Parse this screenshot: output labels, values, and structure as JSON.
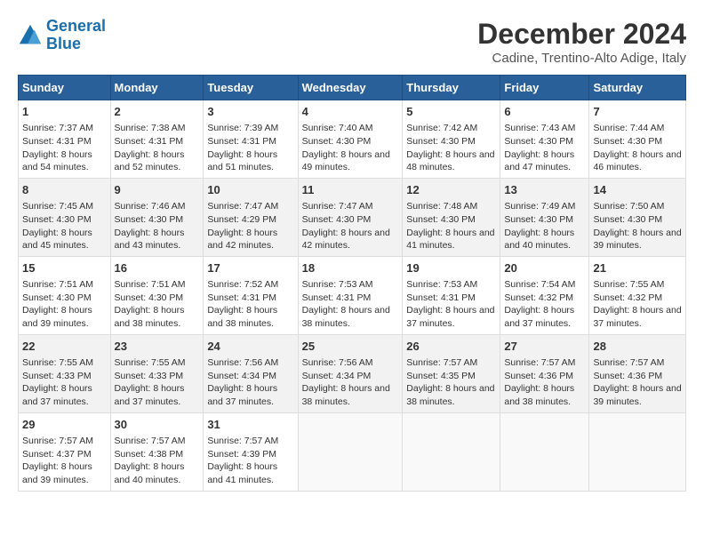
{
  "header": {
    "logo_line1": "General",
    "logo_line2": "Blue",
    "month": "December 2024",
    "location": "Cadine, Trentino-Alto Adige, Italy"
  },
  "days_of_week": [
    "Sunday",
    "Monday",
    "Tuesday",
    "Wednesday",
    "Thursday",
    "Friday",
    "Saturday"
  ],
  "weeks": [
    [
      {
        "day": "1",
        "sunrise": "7:37 AM",
        "sunset": "4:31 PM",
        "daylight": "8 hours and 54 minutes."
      },
      {
        "day": "2",
        "sunrise": "7:38 AM",
        "sunset": "4:31 PM",
        "daylight": "8 hours and 52 minutes."
      },
      {
        "day": "3",
        "sunrise": "7:39 AM",
        "sunset": "4:31 PM",
        "daylight": "8 hours and 51 minutes."
      },
      {
        "day": "4",
        "sunrise": "7:40 AM",
        "sunset": "4:30 PM",
        "daylight": "8 hours and 49 minutes."
      },
      {
        "day": "5",
        "sunrise": "7:42 AM",
        "sunset": "4:30 PM",
        "daylight": "8 hours and 48 minutes."
      },
      {
        "day": "6",
        "sunrise": "7:43 AM",
        "sunset": "4:30 PM",
        "daylight": "8 hours and 47 minutes."
      },
      {
        "day": "7",
        "sunrise": "7:44 AM",
        "sunset": "4:30 PM",
        "daylight": "8 hours and 46 minutes."
      }
    ],
    [
      {
        "day": "8",
        "sunrise": "7:45 AM",
        "sunset": "4:30 PM",
        "daylight": "8 hours and 45 minutes."
      },
      {
        "day": "9",
        "sunrise": "7:46 AM",
        "sunset": "4:30 PM",
        "daylight": "8 hours and 43 minutes."
      },
      {
        "day": "10",
        "sunrise": "7:47 AM",
        "sunset": "4:29 PM",
        "daylight": "8 hours and 42 minutes."
      },
      {
        "day": "11",
        "sunrise": "7:47 AM",
        "sunset": "4:30 PM",
        "daylight": "8 hours and 42 minutes."
      },
      {
        "day": "12",
        "sunrise": "7:48 AM",
        "sunset": "4:30 PM",
        "daylight": "8 hours and 41 minutes."
      },
      {
        "day": "13",
        "sunrise": "7:49 AM",
        "sunset": "4:30 PM",
        "daylight": "8 hours and 40 minutes."
      },
      {
        "day": "14",
        "sunrise": "7:50 AM",
        "sunset": "4:30 PM",
        "daylight": "8 hours and 39 minutes."
      }
    ],
    [
      {
        "day": "15",
        "sunrise": "7:51 AM",
        "sunset": "4:30 PM",
        "daylight": "8 hours and 39 minutes."
      },
      {
        "day": "16",
        "sunrise": "7:51 AM",
        "sunset": "4:30 PM",
        "daylight": "8 hours and 38 minutes."
      },
      {
        "day": "17",
        "sunrise": "7:52 AM",
        "sunset": "4:31 PM",
        "daylight": "8 hours and 38 minutes."
      },
      {
        "day": "18",
        "sunrise": "7:53 AM",
        "sunset": "4:31 PM",
        "daylight": "8 hours and 38 minutes."
      },
      {
        "day": "19",
        "sunrise": "7:53 AM",
        "sunset": "4:31 PM",
        "daylight": "8 hours and 37 minutes."
      },
      {
        "day": "20",
        "sunrise": "7:54 AM",
        "sunset": "4:32 PM",
        "daylight": "8 hours and 37 minutes."
      },
      {
        "day": "21",
        "sunrise": "7:55 AM",
        "sunset": "4:32 PM",
        "daylight": "8 hours and 37 minutes."
      }
    ],
    [
      {
        "day": "22",
        "sunrise": "7:55 AM",
        "sunset": "4:33 PM",
        "daylight": "8 hours and 37 minutes."
      },
      {
        "day": "23",
        "sunrise": "7:55 AM",
        "sunset": "4:33 PM",
        "daylight": "8 hours and 37 minutes."
      },
      {
        "day": "24",
        "sunrise": "7:56 AM",
        "sunset": "4:34 PM",
        "daylight": "8 hours and 37 minutes."
      },
      {
        "day": "25",
        "sunrise": "7:56 AM",
        "sunset": "4:34 PM",
        "daylight": "8 hours and 38 minutes."
      },
      {
        "day": "26",
        "sunrise": "7:57 AM",
        "sunset": "4:35 PM",
        "daylight": "8 hours and 38 minutes."
      },
      {
        "day": "27",
        "sunrise": "7:57 AM",
        "sunset": "4:36 PM",
        "daylight": "8 hours and 38 minutes."
      },
      {
        "day": "28",
        "sunrise": "7:57 AM",
        "sunset": "4:36 PM",
        "daylight": "8 hours and 39 minutes."
      }
    ],
    [
      {
        "day": "29",
        "sunrise": "7:57 AM",
        "sunset": "4:37 PM",
        "daylight": "8 hours and 39 minutes."
      },
      {
        "day": "30",
        "sunrise": "7:57 AM",
        "sunset": "4:38 PM",
        "daylight": "8 hours and 40 minutes."
      },
      {
        "day": "31",
        "sunrise": "7:57 AM",
        "sunset": "4:39 PM",
        "daylight": "8 hours and 41 minutes."
      },
      null,
      null,
      null,
      null
    ]
  ]
}
